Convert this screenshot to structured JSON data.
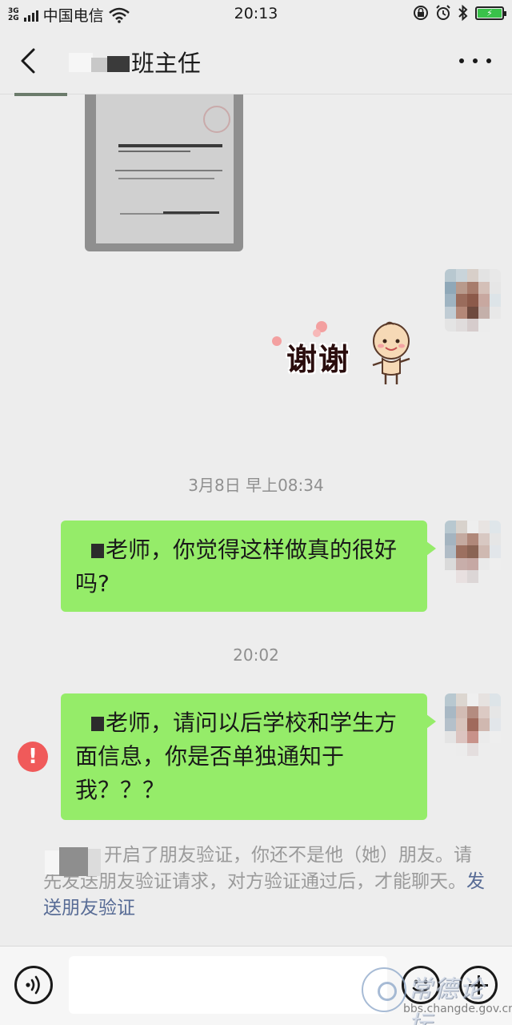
{
  "status_bar": {
    "network_type": "3G 2G",
    "carrier": "中国电信",
    "time": "20:13",
    "battery_level": 1.0,
    "battery_color": "#39c24a",
    "icons": [
      "signal-icon",
      "wifi-icon",
      "lock-rotation-icon",
      "alarm-icon",
      "bluetooth-icon",
      "battery-charging-icon"
    ]
  },
  "header": {
    "back_icon": "chevron-left-icon",
    "title": "班主任",
    "more_icon": "more-dots-icon"
  },
  "messages": {
    "sticker_text": "谢谢",
    "timestamp_1": "3月8日 早上08:34",
    "bubble_1": "老师，你觉得这样做真的很好吗?",
    "timestamp_2": "20:02",
    "bubble_2": "老师，请问以后学校和学生方面信息，你是否单独通知于我？？？",
    "bubble_2_status": "!",
    "bubble_color": "#95ec69"
  },
  "system_notice": {
    "text": "开启了朋友验证，你还不是他（她）朋友。请先发送朋友验证请求，对方验证通过后，才能聊天。",
    "link": "发送朋友验证",
    "link_color": "#576b95"
  },
  "input_bar": {
    "voice_icon": "voice-input-icon",
    "emoji_icon": "emoji-icon",
    "plus_icon": "plus-circle-icon",
    "input_value": ""
  },
  "watermark": {
    "big_text": "常德论坛",
    "url": "bbs.changde.gov.cn"
  }
}
